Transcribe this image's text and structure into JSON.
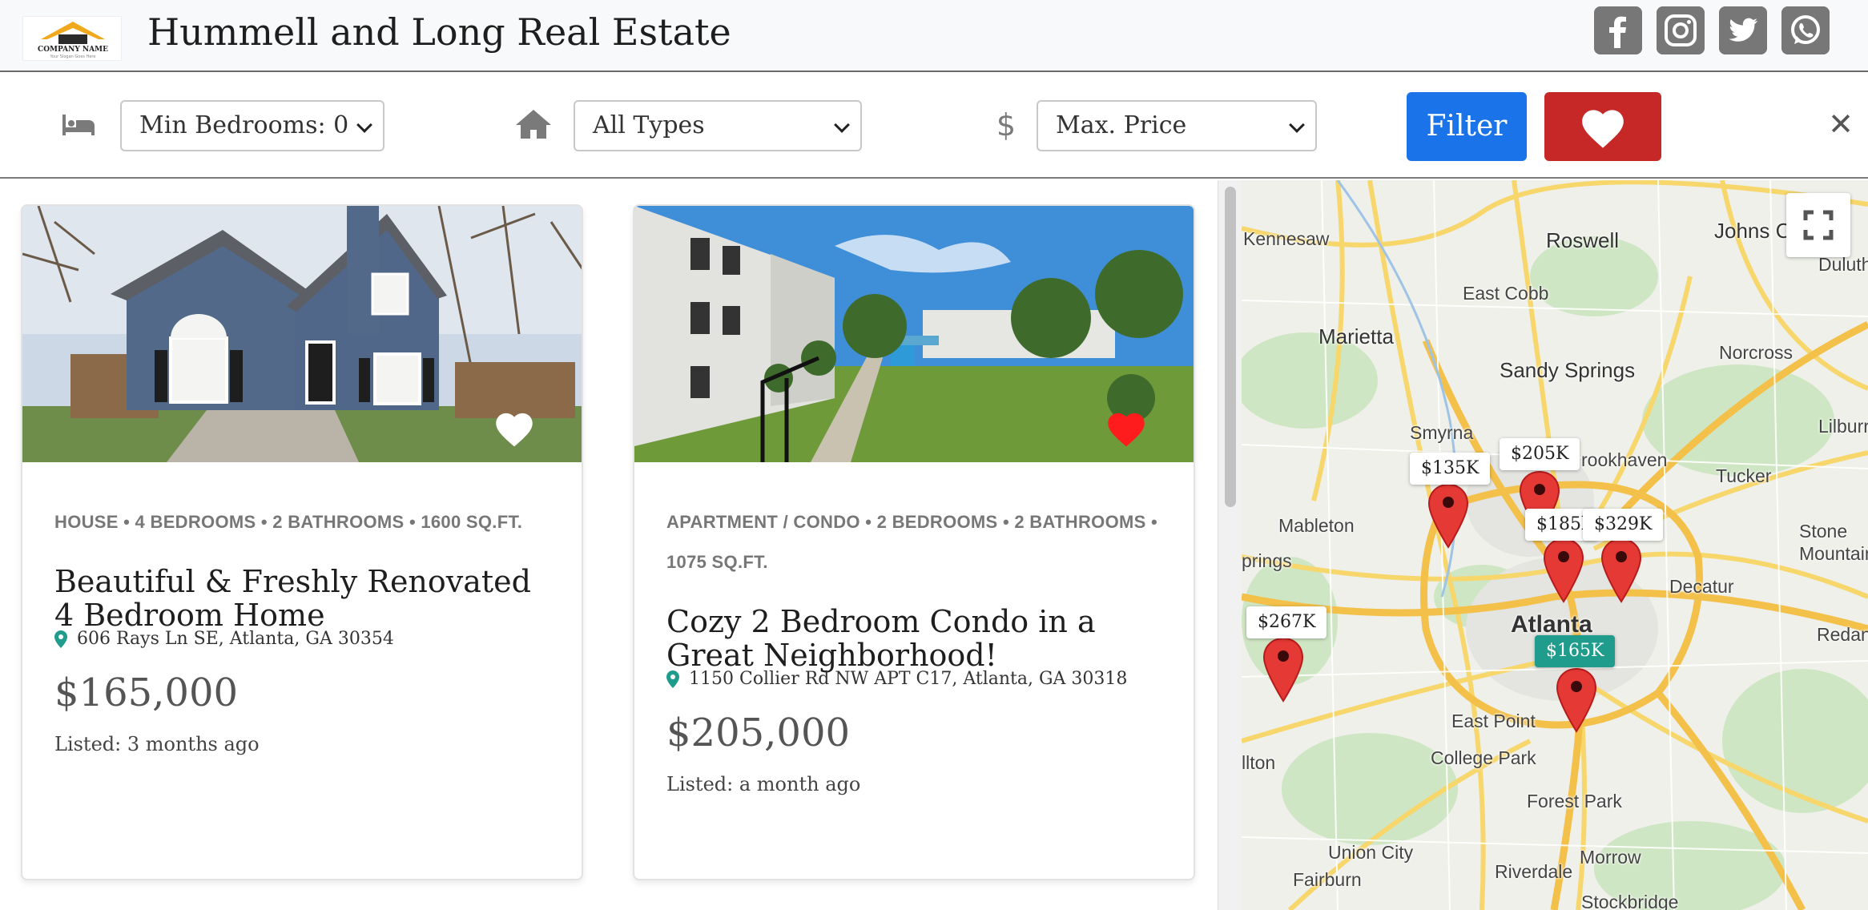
{
  "header": {
    "title": "Hummell and Long Real Estate",
    "logo": {
      "company_name": "COMPANY NAME",
      "slogan": "Your Slogan Goes Here"
    },
    "social": [
      "facebook-icon",
      "instagram-icon",
      "twitter-icon",
      "whatsapp-icon"
    ]
  },
  "filters": {
    "bedrooms": {
      "icon": "bed-icon",
      "selected": "Min Bedrooms: 0"
    },
    "type": {
      "icon": "home-icon",
      "selected": "All Types"
    },
    "price": {
      "icon": "dollar-icon",
      "selected": "Max. Price"
    },
    "filter_label": "Filter",
    "favorites_icon": "heart-icon",
    "close_glyph": "✕"
  },
  "listings": [
    {
      "meta": "HOUSE • 4 BEDROOMS • 2 BATHROOMS • 1600 SQ.FT.",
      "title": "Beautiful & Freshly Renovated 4 Bedroom Home",
      "address": "606 Rays Ln SE, Atlanta, GA 30354",
      "price": "$165,000",
      "listed": "Listed: 3 months ago",
      "favorited": false
    },
    {
      "meta": "APARTMENT / CONDO • 2 BEDROOMS • 2 BATHROOMS • 1075 SQ.FT.",
      "title": "Cozy 2 Bedroom Condo in a Great Neighborhood!",
      "address": "1150 Collier Rd NW APT C17, Atlanta, GA 30318",
      "price": "$205,000",
      "listed": "Listed: a month ago",
      "favorited": true
    }
  ],
  "map": {
    "labels": {
      "kennesaw": "Kennesaw",
      "roswell": "Roswell",
      "johns_creek": "Johns C",
      "duluth": "Duluth",
      "east_cobb": "East Cobb",
      "marietta": "Marietta",
      "sandy_springs": "Sandy Springs",
      "norcross": "Norcross",
      "lilburn": "Lilburr",
      "smyrna": "Smyrna",
      "brookhaven": "rookhaven",
      "tucker": "Tucker",
      "mableton": "Mableton",
      "stone_mountain": "Stone Mountain",
      "springs": "prings",
      "decatur": "Decatur",
      "atlanta": "Atlanta",
      "redan": "Redan",
      "east_point": "East Point",
      "college_park": "College Park",
      "hilton": "llton",
      "forest_park": "Forest Park",
      "union_city": "Union City",
      "morrow": "Morrow",
      "fairburn": "Fairburn",
      "riverdale": "Riverdale",
      "stockbridge": "Stockbridge"
    },
    "price_tags": {
      "p135": "$135K",
      "p205": "$205K",
      "p185": "$185l",
      "p329": "$329K",
      "p267": "$267K",
      "p165": "$165K"
    },
    "accent_active": "#1f9c8c",
    "marker_color": "#e53935"
  }
}
